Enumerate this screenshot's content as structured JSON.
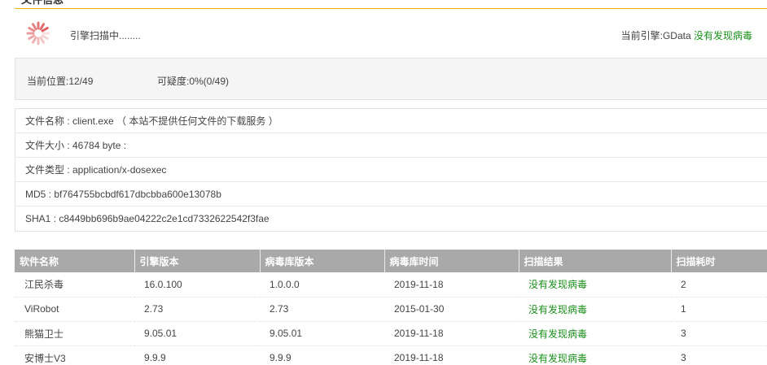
{
  "section": {
    "title": "文件信息"
  },
  "scan": {
    "status": "引擎扫描中........",
    "engine_label": "当前引擎:GData",
    "engine_result": "没有发现病毒"
  },
  "progress": {
    "position": "当前位置:12/49",
    "suspicion": "可疑度:0%(0/49)"
  },
  "file_info": [
    "文件名称 : client.exe （ 本站不提供任何文件的下载服务 ）",
    "文件大小 : 46784 byte :",
    "文件类型 : application/x-dosexec",
    "MD5 : bf764755bcbdf617dbcbba600e13078b",
    "SHA1 : c8449bb696b9ae04222c2e1cd7332622542f3fae"
  ],
  "table": {
    "headers": [
      "软件名称",
      "引擎版本",
      "病毒库版本",
      "病毒库时间",
      "扫描结果",
      "扫描耗时"
    ],
    "rows": [
      [
        "江民杀毒",
        "16.0.100",
        "1.0.0.0",
        "2019-11-18",
        "没有发现病毒",
        "2"
      ],
      [
        "ViRobot",
        "2.73",
        "2.73",
        "2015-01-30",
        "没有发现病毒",
        "1"
      ],
      [
        "熊猫卫士",
        "9.05.01",
        "9.05.01",
        "2019-11-18",
        "没有发现病毒",
        "3"
      ],
      [
        "安博士V3",
        "9.9.9",
        "9.9.9",
        "2019-11-18",
        "没有发现病毒",
        "3"
      ]
    ]
  },
  "colors": {
    "accent_line": "#f0b400",
    "header_bg": "#a9a9a9",
    "clean_result": "#1a8f1a",
    "spinner": "#e06060"
  },
  "icons": {
    "spinner": "loading-spinner-icon"
  }
}
